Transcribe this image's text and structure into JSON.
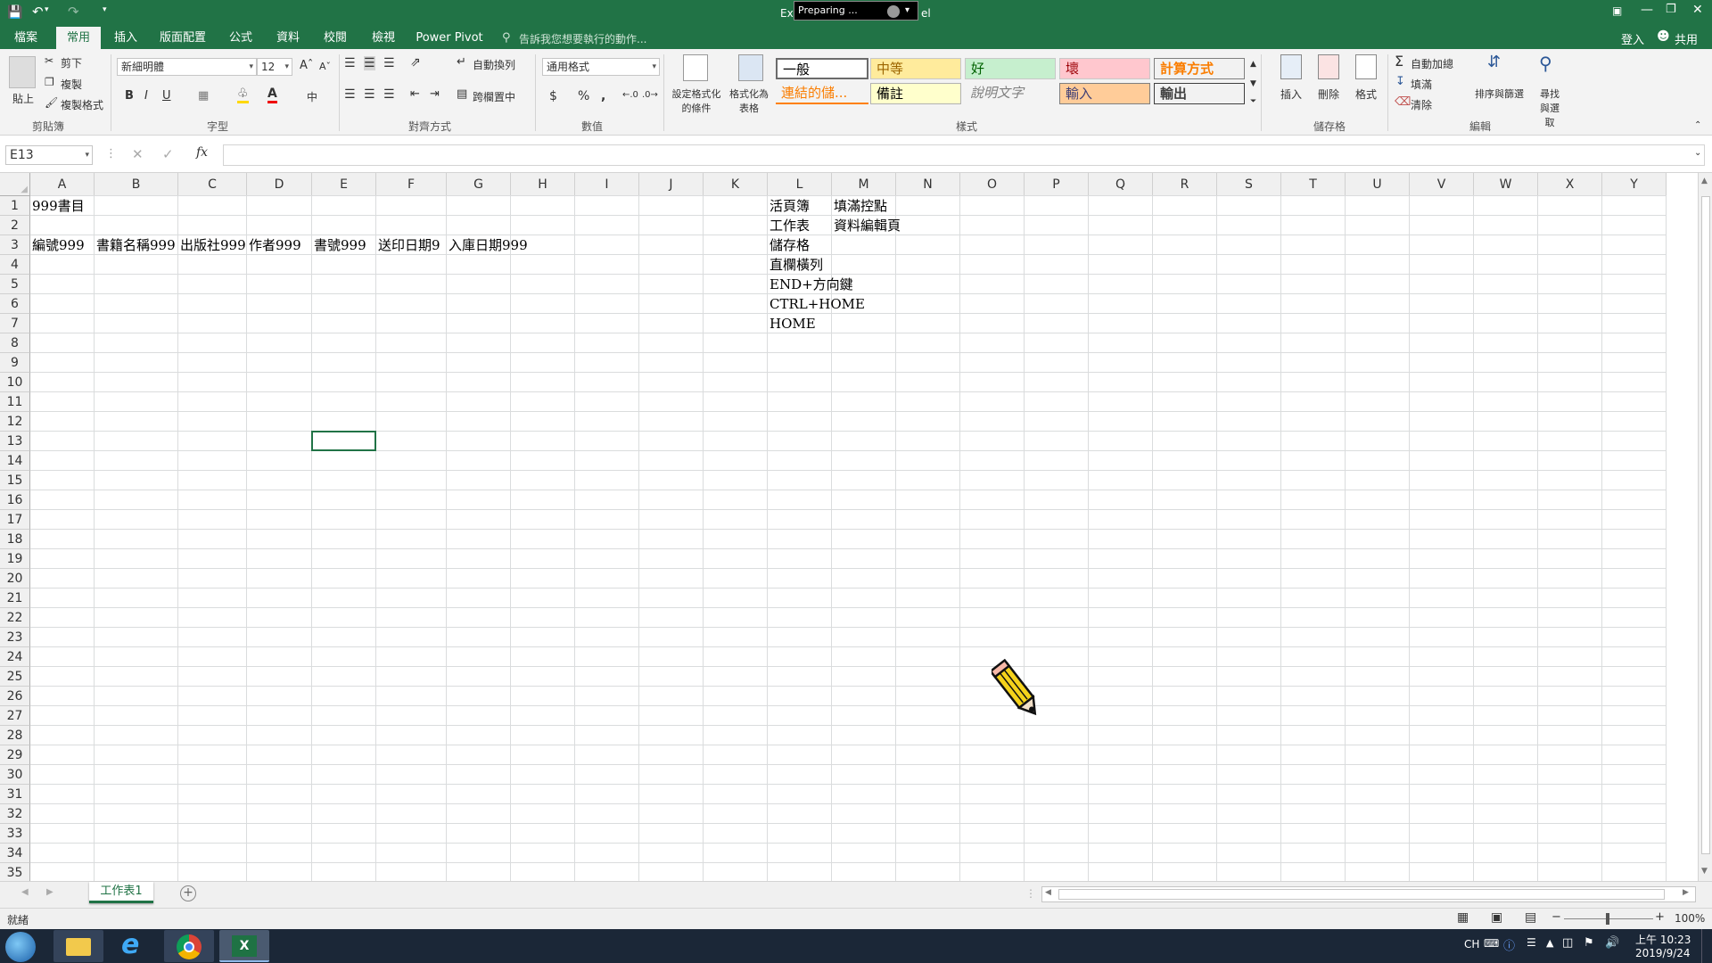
{
  "titlebar": {
    "title_left": "Ex",
    "title_right": "el",
    "preparing": "Preparing ..."
  },
  "tabs": [
    "檔案",
    "常用",
    "插入",
    "版面配置",
    "公式",
    "資料",
    "校閱",
    "檢視",
    "Power Pivot"
  ],
  "tell_me": "告訴我您想要執行的動作...",
  "account": {
    "sign_in": "登入",
    "share": "共用"
  },
  "ribbon": {
    "clipboard": {
      "paste": "貼上",
      "cut": "剪下",
      "copy": "複製",
      "format_painter": "複製格式",
      "group": "剪貼簿"
    },
    "font": {
      "name": "新細明體",
      "size": "12",
      "bold": "B",
      "italic": "I",
      "underline": "U",
      "group": "字型"
    },
    "alignment": {
      "wrap": "自動換列",
      "merge": "跨欄置中",
      "group": "對齊方式"
    },
    "number": {
      "format": "通用格式",
      "currency": "$",
      "percent": "%",
      "comma": ",",
      "group": "數值"
    },
    "styles": {
      "conditional": "設定格式化的條件",
      "as_table": "格式化為表格",
      "cells": [
        "一般",
        "中等",
        "好",
        "壞",
        "計算方式",
        "連結的儲...",
        "備註",
        "說明文字",
        "輸入",
        "輸出"
      ],
      "group": "樣式"
    },
    "cells": {
      "insert": "插入",
      "delete": "刪除",
      "format": "格式",
      "group": "儲存格"
    },
    "editing": {
      "autosum": "自動加總",
      "fill": "填滿",
      "clear": "清除",
      "sort": "排序與篩選",
      "find": "尋找與選取",
      "group": "編輯"
    }
  },
  "formula_bar": {
    "name_box": "E13",
    "fx": "fx",
    "value": ""
  },
  "columns": [
    "A",
    "B",
    "C",
    "D",
    "E",
    "F",
    "G",
    "H",
    "I",
    "J",
    "K",
    "L",
    "M",
    "N",
    "O",
    "P",
    "Q",
    "R",
    "S",
    "T",
    "U",
    "V",
    "W",
    "X",
    "Y"
  ],
  "rows": [
    "1",
    "2",
    "3",
    "4",
    "5",
    "6",
    "7",
    "8",
    "9",
    "10",
    "11",
    "12",
    "13",
    "14",
    "15",
    "16",
    "17",
    "18",
    "19",
    "20",
    "21",
    "22",
    "23",
    "24",
    "25",
    "26",
    "27",
    "28",
    "29",
    "30",
    "31",
    "32",
    "33",
    "34",
    "35"
  ],
  "cells": {
    "A1": "999書目",
    "A3": "編號999",
    "B3": "書籍名稱999",
    "C3": "出版社999",
    "D3": "作者999",
    "E3": "書號999",
    "F3": "送印日期9",
    "G3": "入庫日期999",
    "L1": "活頁簿",
    "M1": "填滿控點",
    "L2": "工作表",
    "M2": "資料編輯頁",
    "L3": "儲存格",
    "L4": "直欄橫列",
    "L5": "END+方向鍵",
    "L6": "CTRL+HOME",
    "L7": "HOME"
  },
  "sheet_tab": "工作表1",
  "status": {
    "ready": "就緒",
    "zoom": "100%"
  },
  "taskbar": {
    "lang": "CH",
    "time": "上午 10:23",
    "date": "2019/9/24"
  },
  "colors": {
    "accent": "#217346",
    "taskbar": "#1b2737"
  }
}
